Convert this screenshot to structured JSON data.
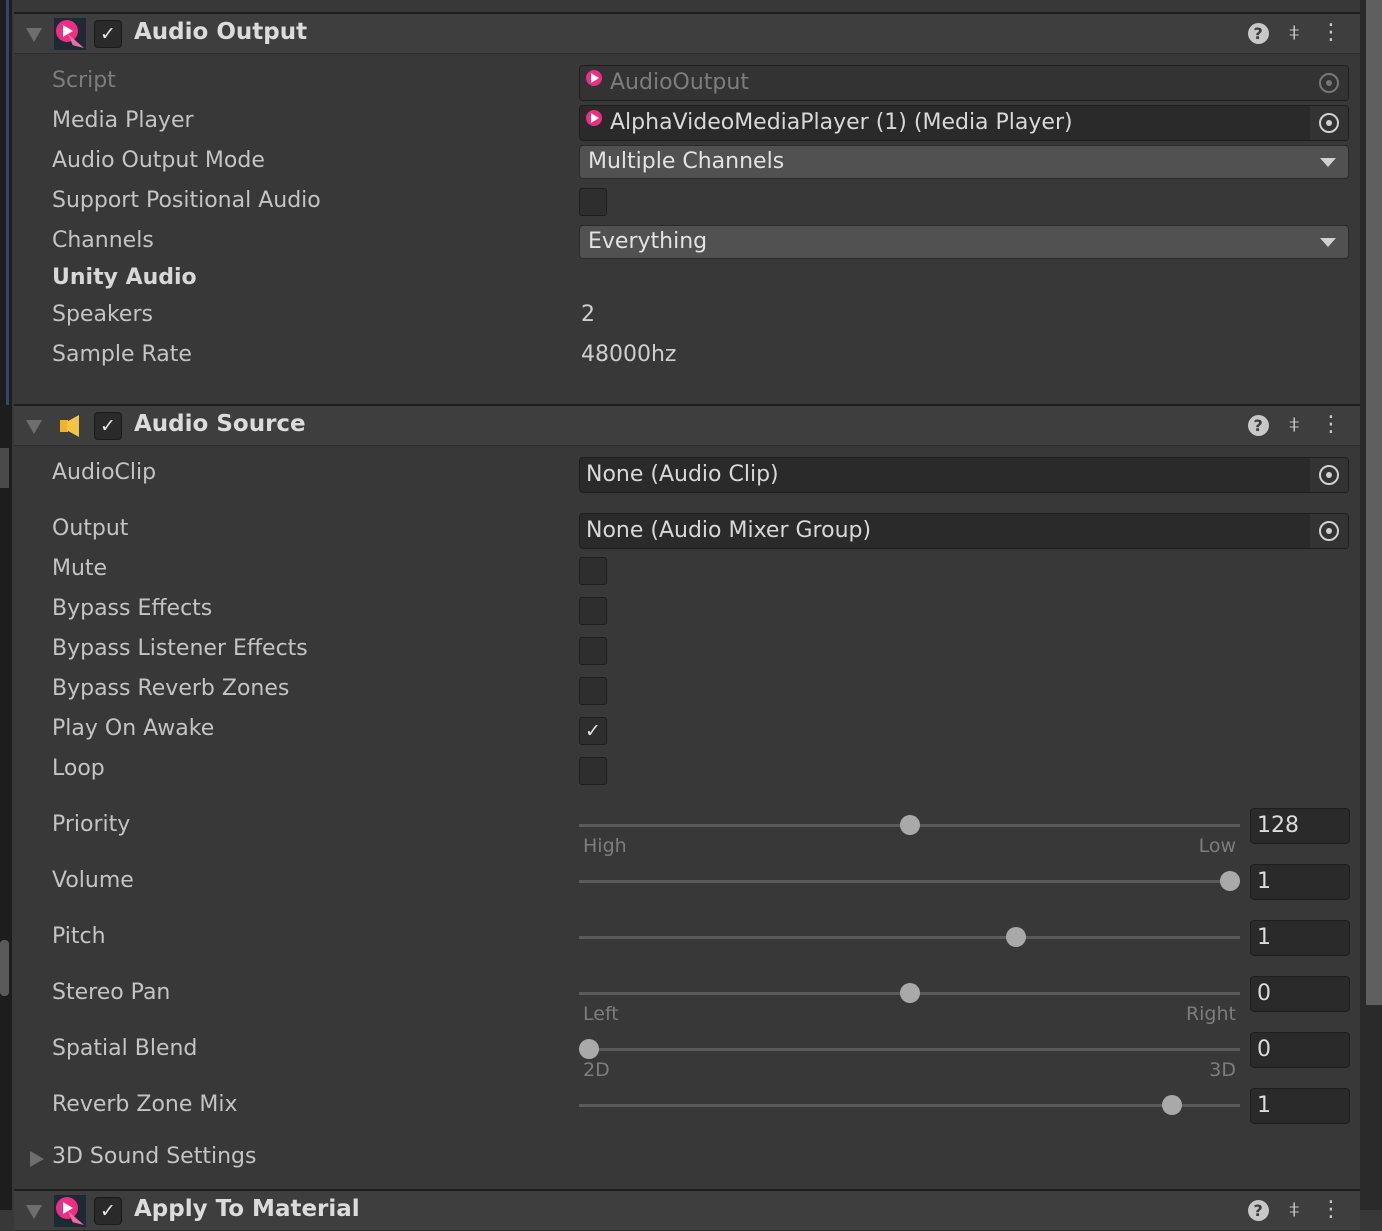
{
  "audio_output": {
    "title": "Audio Output",
    "enabled": true,
    "script_label": "Script",
    "script_value": "AudioOutput",
    "media_player_label": "Media Player",
    "media_player_value": "AlphaVideoMediaPlayer (1) (Media Player)",
    "mode_label": "Audio Output Mode",
    "mode_value": "Multiple Channels",
    "positional_label": "Support Positional Audio",
    "positional": false,
    "channels_label": "Channels",
    "channels_value": "Everything",
    "unity_audio_heading": "Unity Audio",
    "speakers_label": "Speakers",
    "speakers_value": "2",
    "sample_rate_label": "Sample Rate",
    "sample_rate_value": "48000hz"
  },
  "audio_source": {
    "title": "Audio Source",
    "enabled": true,
    "audioclip_label": "AudioClip",
    "audioclip_value": "None (Audio Clip)",
    "output_label": "Output",
    "output_value": "None (Audio Mixer Group)",
    "toggles": [
      {
        "label": "Mute",
        "checked": false
      },
      {
        "label": "Bypass Effects",
        "checked": false
      },
      {
        "label": "Bypass Listener Effects",
        "checked": false
      },
      {
        "label": "Bypass Reverb Zones",
        "checked": false
      },
      {
        "label": "Play On Awake",
        "checked": true
      },
      {
        "label": "Loop",
        "checked": false
      }
    ],
    "sliders": [
      {
        "label": "Priority",
        "value": "128",
        "fraction": 0.5,
        "min_label": "High",
        "max_label": "Low"
      },
      {
        "label": "Volume",
        "value": "1",
        "fraction": 1.0
      },
      {
        "label": "Pitch",
        "value": "1",
        "fraction": 0.6667
      },
      {
        "label": "Stereo Pan",
        "value": "0",
        "fraction": 0.5,
        "min_label": "Left",
        "max_label": "Right"
      },
      {
        "label": "Spatial Blend",
        "value": "0",
        "fraction": 0.0,
        "min_label": "2D",
        "max_label": "3D"
      },
      {
        "label": "Reverb Zone Mix",
        "value": "1",
        "fraction": 0.909
      }
    ],
    "sound_3d_label": "3D Sound Settings"
  },
  "apply_to_material": {
    "title": "Apply To Material",
    "enabled": true
  },
  "header_icons": {
    "help": "?",
    "check": "✓"
  }
}
